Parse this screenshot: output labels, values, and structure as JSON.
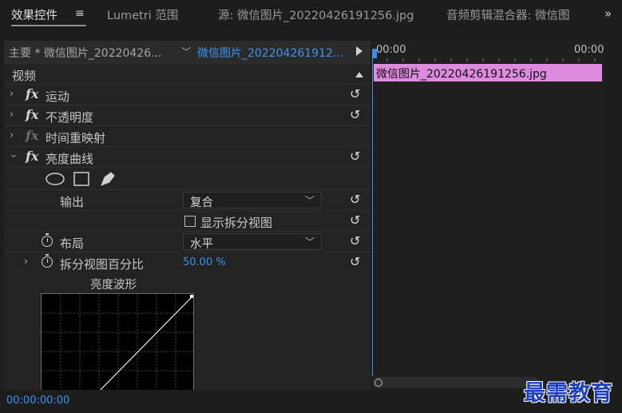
{
  "tabs": [
    {
      "label": "效果控件"
    },
    {
      "label": "Lumetri 范围"
    },
    {
      "label": "源: 微信图片_20220426191256.jpg"
    },
    {
      "label": "音频剪辑混合器: 微信图"
    }
  ],
  "icons": {
    "menu": "≡",
    "overflow": "»",
    "reset": "↺",
    "fx": "fx"
  },
  "header": {
    "master_clip": "主要 * 微信图片_20220426...",
    "active_clip": "微信图片_202204261912..."
  },
  "section": {
    "video_label": "视频"
  },
  "effects": [
    {
      "label": "运动"
    },
    {
      "label": "不透明度"
    },
    {
      "label": "时间重映射"
    },
    {
      "label": "亮度曲线"
    }
  ],
  "params": {
    "output_label": "输出",
    "output_value": "复合",
    "split_view_label": "显示拆分视图",
    "layout_label": "布局",
    "layout_value": "水平",
    "split_percent_label": "拆分视图百分比",
    "split_percent_value": "50.00 %"
  },
  "waveform": {
    "title": "亮度波形"
  },
  "timecode": "00:00:00:00",
  "timeline": {
    "time_start": "00:00",
    "time_end": "00:00",
    "clip_name": "微信图片_20220426191256.jpg",
    "clip_color": "#dd8bdf"
  },
  "watermark": "最需教育",
  "colors": {
    "accent_blue": "#3c94f0",
    "background": "#1d1d1d"
  }
}
